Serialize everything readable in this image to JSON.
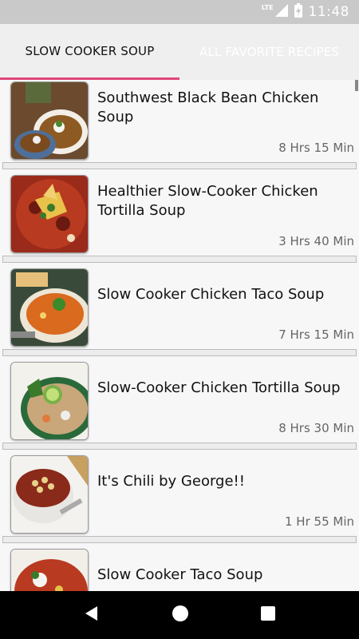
{
  "status": {
    "network": "LTE",
    "time": "11:48"
  },
  "tabs": [
    {
      "label": "SLOW COOKER SOUP"
    },
    {
      "label": "ALL FAVORITE RECIPES"
    }
  ],
  "recipes": [
    {
      "title": "Southwest Black Bean Chicken Soup",
      "time": "8 Hrs 15 Min"
    },
    {
      "title": "Healthier Slow-Cooker Chicken Tortilla Soup",
      "time": "3 Hrs 40 Min"
    },
    {
      "title": "Slow Cooker Chicken Taco Soup",
      "time": "7 Hrs 15 Min"
    },
    {
      "title": "Slow-Cooker Chicken Tortilla Soup",
      "time": "8 Hrs 30 Min"
    },
    {
      "title": "It's Chili by George!!",
      "time": "1 Hr 55 Min"
    },
    {
      "title": "Slow Cooker Taco Soup",
      "time": ""
    }
  ],
  "icons": {
    "signal": "signal-icon",
    "battery": "battery-charging-icon",
    "back": "back-icon",
    "home": "home-icon",
    "recents": "recents-icon"
  }
}
